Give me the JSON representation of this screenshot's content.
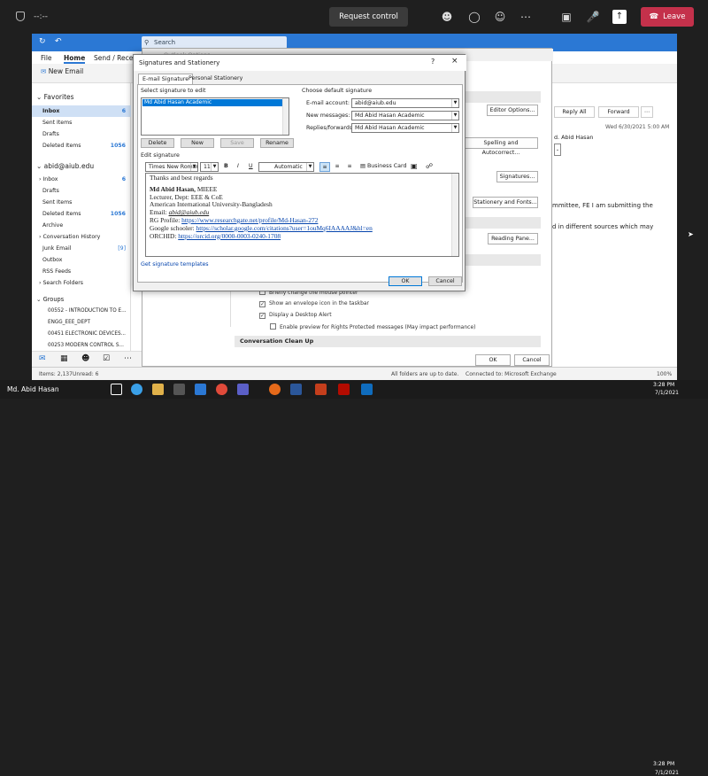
{
  "teams": {
    "timer": "--:--",
    "request_control": "Request control",
    "leave": "Leave",
    "speaker_name": "Md. Abid Hasan"
  },
  "outlook": {
    "search": "Search",
    "menu": [
      "File",
      "Home",
      "Send / Receive"
    ],
    "new_email": "New Email",
    "nav": {
      "favorites": "Favorites",
      "favorites_items": [
        {
          "label": "Inbox",
          "count": "6"
        },
        {
          "label": "Sent Items",
          "count": ""
        },
        {
          "label": "Drafts",
          "count": ""
        },
        {
          "label": "Deleted Items",
          "count": "1056"
        }
      ],
      "account": "abid@aiub.edu",
      "account_items": [
        {
          "label": "Inbox",
          "count": "6"
        },
        {
          "label": "Drafts",
          "count": ""
        },
        {
          "label": "Sent Items",
          "count": ""
        },
        {
          "label": "Deleted Items",
          "count": "1056"
        },
        {
          "label": "Archive",
          "count": ""
        },
        {
          "label": "Conversation History",
          "count": ""
        },
        {
          "label": "Junk Email",
          "count": "[9]"
        },
        {
          "label": "Outbox",
          "count": ""
        },
        {
          "label": "RSS Feeds",
          "count": ""
        },
        {
          "label": "Search Folders",
          "count": ""
        }
      ],
      "groups": "Groups",
      "group_items": [
        "00552 - INTRODUCTION TO E...",
        "ENGG_EEE_DEPT",
        "00451 ELECTRONIC DEVICES...",
        "00253 MODERN CONTROL S..."
      ]
    },
    "status": {
      "items": "Items: 2,137",
      "unread": "Unread: 6",
      "folders": "All folders are up to date.",
      "connected": "Connected to: Microsoft Exchange",
      "zoom": "100%"
    },
    "reading": {
      "reply_all": "Reply All",
      "forward": "Forward",
      "date": "Wed 6/30/2021 5:00 AM",
      "sender": "d. Abid Hasan",
      "line1": "mmittee, FE I am submitting the",
      "line2": "d in different sources which may"
    }
  },
  "options": {
    "title": "Outlook Options",
    "editor_options": "Editor Options...",
    "spelling": "Spelling and Autocorrect...",
    "signatures": "Signatures...",
    "stationery": "Stationery and Fonts...",
    "reading_pane": "Reading Pane...",
    "chk1": "Briefly change the mouse pointer",
    "chk2": "Show an envelope icon in the taskbar",
    "chk3": "Display a Desktop Alert",
    "chk4": "Enable preview for Rights Protected messages (May impact performance)",
    "section": "Conversation Clean Up",
    "ok": "OK",
    "cancel": "Cancel"
  },
  "dialog": {
    "title": "Signatures and Stationery",
    "help": "?",
    "close": "×",
    "tab_email": "E-mail Signature",
    "tab_personal": "Personal Stationery",
    "select_label": "Select signature to edit",
    "sig_item": "Md Abid Hasan Academic",
    "delete": "Delete",
    "new": "New",
    "save": "Save",
    "rename": "Rename",
    "default_label": "Choose default signature",
    "email_account_label": "E-mail account:",
    "email_account_value": "abid@aiub.edu",
    "new_messages_label": "New messages:",
    "new_messages_value": "Md Abid Hasan Academic",
    "replies_label": "Replies/forwards:",
    "replies_value": "Md Abid Hasan Academic",
    "edit_label": "Edit signature",
    "font": "Times New Roman",
    "size": "11",
    "bold": "B",
    "italic": "I",
    "underline": "U",
    "color": "Automatic",
    "business_card": "Business Card",
    "sig_lines": {
      "l1": "Thanks and best regards",
      "l2a": "Md Abid Hasan,",
      "l2b": " MIEEE",
      "l3": "Lecturer, Dept: EEE & CoE",
      "l4": "American International University-Bangladesh",
      "l5a": "Email: ",
      "l5b": "abid@aiub.edu",
      "l6a": "RG Profile: ",
      "l6b": "https://www.researchgate.net/profile/Md-Hasan-272",
      "l7a": "Google schooler: ",
      "l7b": "https://scholar.google.com/citations?user=1ouMq6IAAAAJ&hl=en",
      "l8a": "ORCHID: ",
      "l8b": "https://orcid.org/0000-0003-0240-1708"
    },
    "templates_link": "Get signature templates",
    "ok": "OK",
    "cancel": "Cancel"
  },
  "taskbar": {
    "time": "3:28 PM",
    "date": "7/1/2021"
  }
}
